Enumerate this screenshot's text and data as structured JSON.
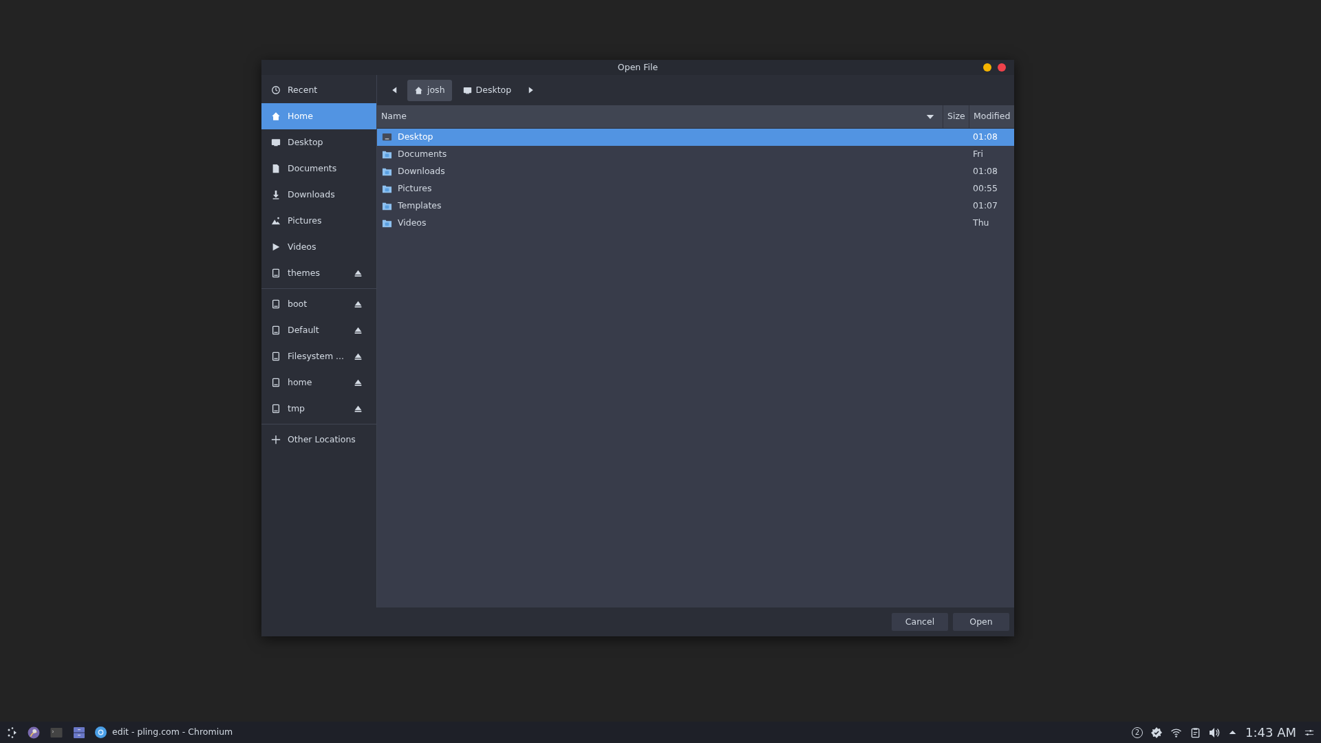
{
  "window": {
    "title": "Open File"
  },
  "sidebar": {
    "sections": [
      [
        {
          "label": "Recent",
          "kind": "recent",
          "selected": false
        },
        {
          "label": "Home",
          "kind": "home",
          "selected": true
        },
        {
          "label": "Desktop",
          "kind": "desktop",
          "selected": false
        },
        {
          "label": "Documents",
          "kind": "documents",
          "selected": false
        },
        {
          "label": "Downloads",
          "kind": "downloads",
          "selected": false
        },
        {
          "label": "Pictures",
          "kind": "pictures",
          "selected": false
        },
        {
          "label": "Videos",
          "kind": "videos",
          "selected": false
        },
        {
          "label": "themes",
          "kind": "drive",
          "selected": false
        }
      ],
      [
        {
          "label": "boot",
          "kind": "drive",
          "selected": false
        },
        {
          "label": "Default",
          "kind": "drive",
          "selected": false
        },
        {
          "label": "Filesystem ...",
          "kind": "drive",
          "selected": false
        },
        {
          "label": "home",
          "kind": "drive",
          "selected": false
        },
        {
          "label": "tmp",
          "kind": "drive",
          "selected": false
        }
      ],
      [
        {
          "label": "Other Locations",
          "kind": "add",
          "selected": false
        }
      ]
    ]
  },
  "path_bar": {
    "segments": [
      {
        "label": "josh",
        "kind": "home",
        "selected": true
      },
      {
        "label": "Desktop",
        "kind": "desktop",
        "selected": false
      }
    ]
  },
  "table": {
    "columns": [
      "Name",
      "Size",
      "Modified"
    ],
    "rows": [
      {
        "name": "Desktop",
        "kind": "desktop",
        "modified": "01:08",
        "selected": true
      },
      {
        "name": "Documents",
        "kind": "folder",
        "modified": "Fri",
        "selected": false
      },
      {
        "name": "Downloads",
        "kind": "folder",
        "modified": "01:08",
        "selected": false
      },
      {
        "name": "Pictures",
        "kind": "folder",
        "modified": "00:55",
        "selected": false
      },
      {
        "name": "Templates",
        "kind": "folder",
        "modified": "01:07",
        "selected": false
      },
      {
        "name": "Videos",
        "kind": "folder",
        "modified": "Thu",
        "selected": false
      }
    ]
  },
  "buttons": [
    "Cancel",
    "Open"
  ],
  "taskbar": {
    "tasks": [
      {
        "label": "edit - pling.com - Chromium"
      }
    ],
    "notifications": "2",
    "clock": "1:43 AM"
  }
}
